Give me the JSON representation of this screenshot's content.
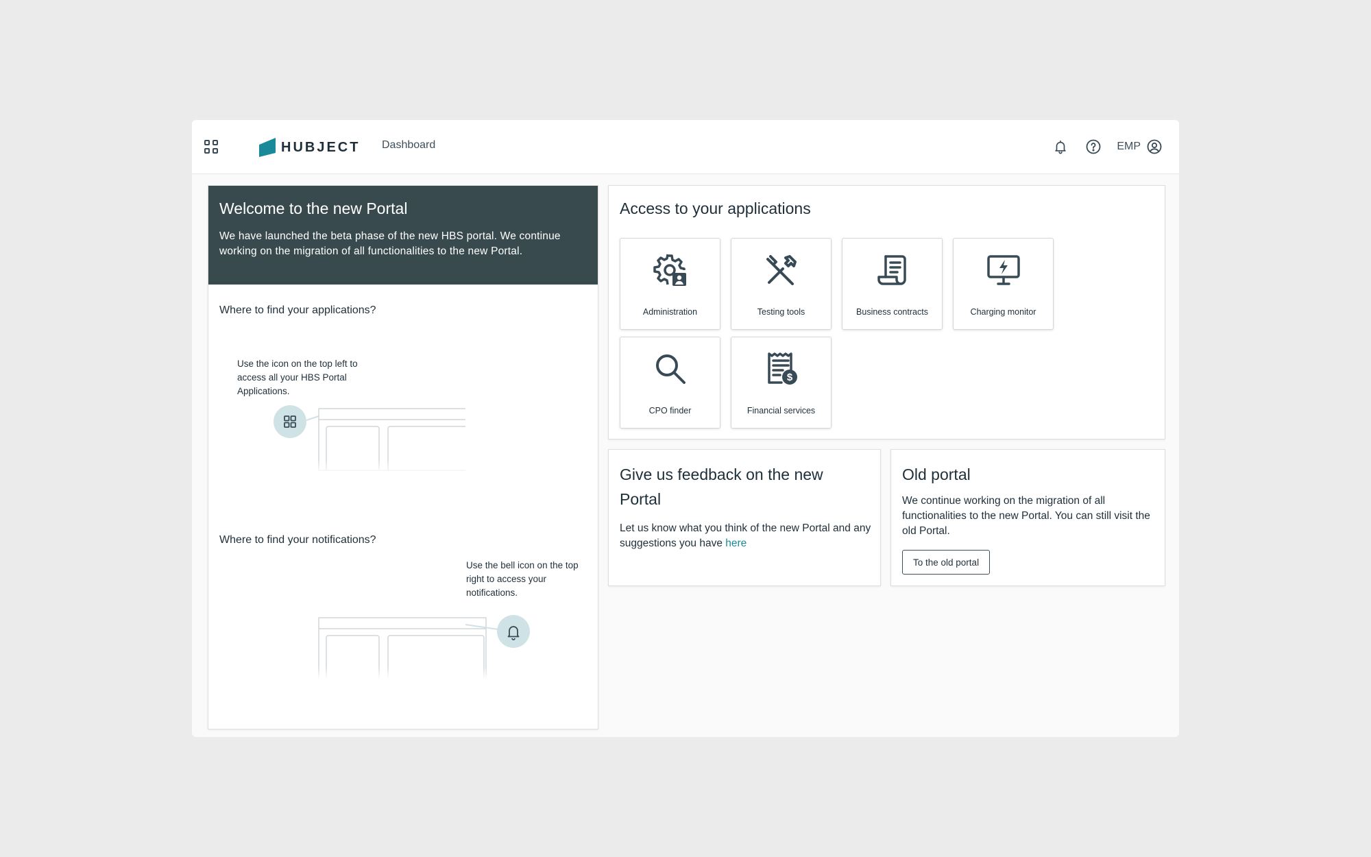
{
  "header": {
    "apps_menu_icon": "apps-grid-icon",
    "logo_text": "HUBJECT",
    "nav_dashboard": "Dashboard",
    "user_label": "EMP",
    "icons": [
      "bell-icon",
      "help-icon",
      "user-circle-icon"
    ]
  },
  "welcome": {
    "title": "Welcome to the new Portal",
    "text": "We have launched the beta phase of the new HBS portal. We continue working on the migration of all functionalities to the new Portal.",
    "apps_question": "Where to find your applications?",
    "apps_tip": "Use the icon on the top left to access all your HBS Portal Applications.",
    "notif_question": "Where to find your notifications?",
    "notif_tip": "Use the bell icon on the top right to access your notifications."
  },
  "applications": {
    "title": "Access to your applications",
    "tiles": [
      {
        "label": "Administration",
        "icon": "gear-user-icon"
      },
      {
        "label": "Testing tools",
        "icon": "tools-icon"
      },
      {
        "label": "Business contracts",
        "icon": "contract-scroll-icon"
      },
      {
        "label": "Charging monitor",
        "icon": "monitor-bolt-icon"
      },
      {
        "label": "CPO finder",
        "icon": "search-icon"
      },
      {
        "label": "Financial services",
        "icon": "receipt-dollar-icon"
      }
    ]
  },
  "feedback": {
    "title": "Give us feedback on the new Portal",
    "text": "Let us know what you think of the new Portal and any suggestions you have",
    "link_text": "here"
  },
  "old_portal": {
    "title": "Old portal",
    "text": "We continue working on the migration of all functionalities to the new Portal. You can still visit the old Portal.",
    "button_label": "To the old portal"
  },
  "colors": {
    "brand_teal": "#1a8a9a",
    "hero_bg": "#394a4f",
    "page_bg": "#ebebeb",
    "highlight_circle": "#cfe3e6"
  }
}
